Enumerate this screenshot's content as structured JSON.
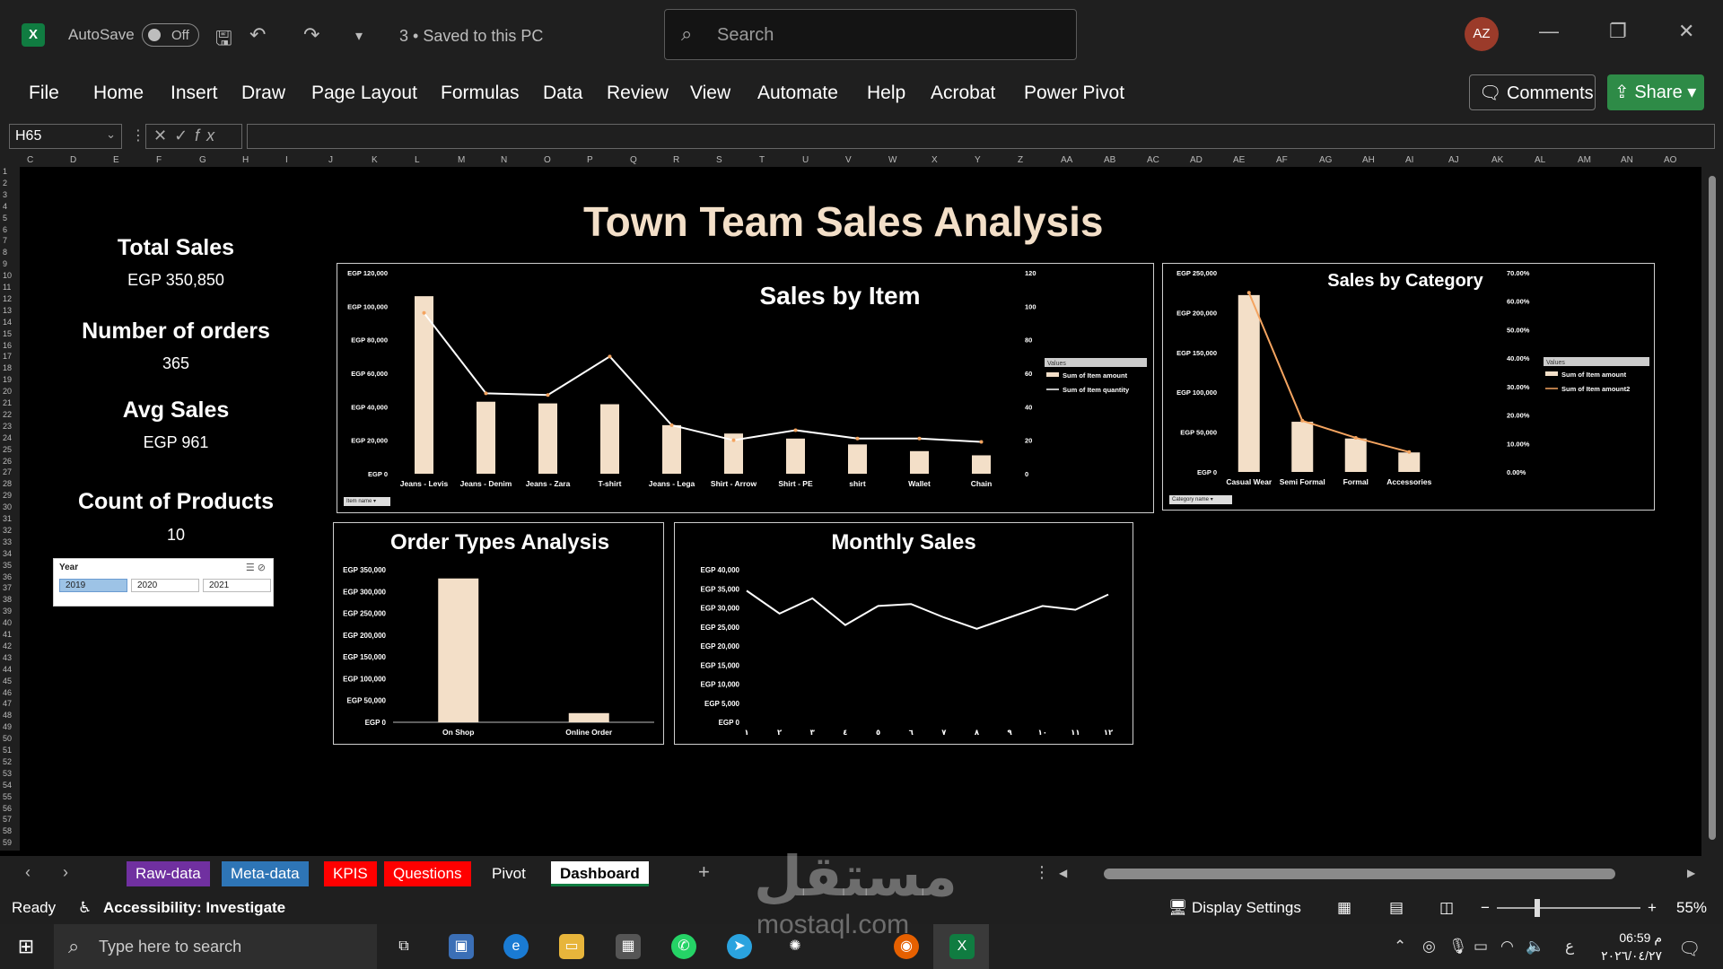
{
  "app": {
    "autosave_label": "AutoSave",
    "autosave_state": "Off",
    "document_status": "3 • Saved to this PC",
    "search_placeholder": "Search",
    "user_initials": "AZ"
  },
  "menu": [
    "File",
    "Home",
    "Insert",
    "Draw",
    "Page Layout",
    "Formulas",
    "Data",
    "Review",
    "View",
    "Automate",
    "Help",
    "Acrobat",
    "Power Pivot"
  ],
  "actions": {
    "comments": "Comments",
    "share": "Share"
  },
  "formula_bar": {
    "name_box": "H65",
    "formula": ""
  },
  "columns": [
    "C",
    "D",
    "E",
    "F",
    "G",
    "H",
    "I",
    "J",
    "K",
    "L",
    "M",
    "N",
    "O",
    "P",
    "Q",
    "R",
    "S",
    "T",
    "U",
    "V",
    "W",
    "X",
    "Y",
    "Z",
    "AA",
    "AB",
    "AC",
    "AD",
    "AE",
    "AF",
    "AG",
    "AH",
    "AI",
    "AJ",
    "AK",
    "AL",
    "AM",
    "AN",
    "AO"
  ],
  "dashboard": {
    "title": "Town Team Sales Analysis",
    "kpis": [
      {
        "label": "Total Sales",
        "value": "EGP 350,850"
      },
      {
        "label": "Number of orders",
        "value": "365"
      },
      {
        "label": "Avg Sales",
        "value": "EGP 961"
      },
      {
        "label": "Count of Products",
        "value": "10"
      }
    ],
    "slicer": {
      "header": "Year",
      "items": [
        "2019",
        "2020",
        "2021"
      ],
      "selected": "2019"
    }
  },
  "chart_data": [
    {
      "type": "bar",
      "title": "Sales by Item",
      "categories": [
        "Jeans - Levis",
        "Jeans - Denim",
        "Jeans - Zara",
        "T-shirt",
        "Jeans - Lega",
        "Shirt - Arrow",
        "Shirt - PE",
        "shirt",
        "Wallet",
        "Chain"
      ],
      "series": [
        {
          "name": "Sum of Item amount",
          "type": "bar",
          "values": [
            106000,
            43000,
            42000,
            41500,
            29000,
            24000,
            21000,
            17500,
            13500,
            11000
          ]
        },
        {
          "name": "Sum of Item quantity",
          "type": "line",
          "axis": "secondary",
          "values": [
            96,
            48,
            47,
            70,
            29,
            20,
            26,
            21,
            21,
            19
          ]
        }
      ],
      "y_ticks": [
        "EGP 0",
        "EGP 20,000",
        "EGP 40,000",
        "EGP 60,000",
        "EGP 80,000",
        "EGP 100,000",
        "EGP 120,000"
      ],
      "ylim": [
        0,
        120000
      ],
      "y2_ticks": [
        "0",
        "20",
        "40",
        "60",
        "80",
        "100",
        "120"
      ],
      "y2lim": [
        0,
        120
      ],
      "legend_header": "Values",
      "legend_position": "right",
      "field_button": "Item name"
    },
    {
      "type": "bar",
      "title": "Sales by Category",
      "categories": [
        "Casual Wear",
        "Semi Formal",
        "Formal",
        "Accessories"
      ],
      "series": [
        {
          "name": "Sum of Item amount",
          "type": "bar",
          "values": [
            222000,
            63000,
            42000,
            24500
          ]
        },
        {
          "name": "Sum of Item amount2",
          "type": "line",
          "axis": "secondary",
          "values": [
            0.63,
            0.18,
            0.12,
            0.07
          ]
        }
      ],
      "y_ticks": [
        "EGP 0",
        "EGP 50,000",
        "EGP 100,000",
        "EGP 150,000",
        "EGP 200,000",
        "EGP 250,000"
      ],
      "ylim": [
        0,
        250000
      ],
      "y2_ticks": [
        "0.00%",
        "10.00%",
        "20.00%",
        "30.00%",
        "40.00%",
        "50.00%",
        "60.00%",
        "70.00%"
      ],
      "y2lim": [
        0,
        0.7
      ],
      "legend_header": "Values",
      "legend_position": "right",
      "field_button": "Category name"
    },
    {
      "type": "bar",
      "title": "Order Types Analysis",
      "categories": [
        "On Shop",
        "Online Order"
      ],
      "values": [
        330000,
        21000
      ],
      "y_ticks": [
        "EGP 0",
        "EGP 50,000",
        "EGP 100,000",
        "EGP 150,000",
        "EGP 200,000",
        "EGP 250,000",
        "EGP 300,000",
        "EGP 350,000"
      ],
      "ylim": [
        0,
        350000
      ]
    },
    {
      "type": "line",
      "title": "Monthly Sales",
      "categories": [
        "١",
        "٢",
        "٣",
        "٤",
        "٥",
        "٦",
        "٧",
        "٨",
        "٩",
        "١٠",
        "١١",
        "١٢"
      ],
      "values": [
        34500,
        28500,
        32500,
        25500,
        30500,
        31000,
        27500,
        24500,
        27500,
        30500,
        29500,
        33500
      ],
      "y_ticks": [
        "EGP 0",
        "EGP 5,000",
        "EGP 10,000",
        "EGP 15,000",
        "EGP 20,000",
        "EGP 25,000",
        "EGP 30,000",
        "EGP 35,000",
        "EGP 40,000"
      ],
      "ylim": [
        0,
        40000
      ]
    }
  ],
  "sheet_tabs": [
    {
      "label": "Raw-data",
      "color": "#7030a0"
    },
    {
      "label": "Meta-data",
      "color": "#2e75b6"
    },
    {
      "label": "KPIS",
      "color": "#ff0000"
    },
    {
      "label": "Questions",
      "color": "#ff0000"
    },
    {
      "label": "Pivot",
      "color": ""
    },
    {
      "label": "Dashboard",
      "color": "",
      "active": true
    }
  ],
  "status": {
    "ready": "Ready",
    "accessibility": "Accessibility: Investigate",
    "display_settings": "Display Settings",
    "zoom": "55%"
  },
  "taskbar": {
    "search_placeholder": "Type here to search",
    "time": "06:59 م",
    "date": "٢٠٢٦/٠٤/٢٧",
    "lang": "ع"
  },
  "watermark": {
    "main": "مستقل",
    "sub": "mostaql.com"
  },
  "colors": {
    "bar": "#f3dfc8",
    "line": "#ffffff",
    "accent_green": "#107c41"
  }
}
